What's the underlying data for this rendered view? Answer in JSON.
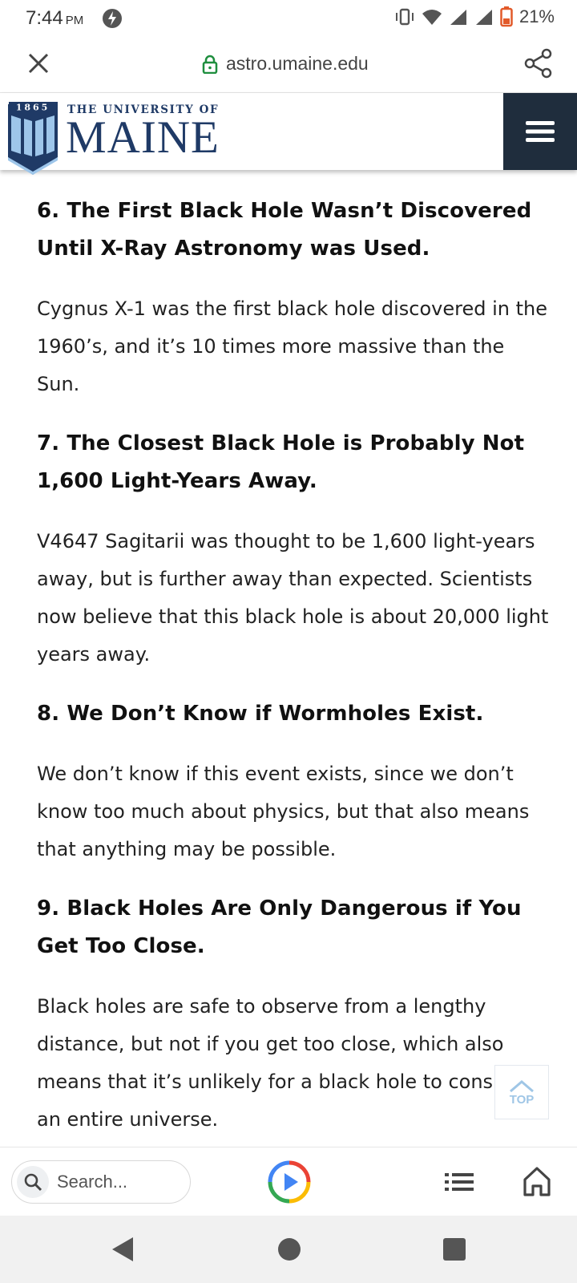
{
  "status_bar": {
    "time": "7:44",
    "ampm": "PM",
    "battery": "21%"
  },
  "browser": {
    "url": "astro.umaine.edu"
  },
  "site": {
    "logo_year": "1865",
    "logo_line1": "THE UNIVERSITY OF",
    "logo_line2": "MAINE",
    "brand_color": "#1f2d3d"
  },
  "article": {
    "sections": [
      {
        "title": "6. The First Black Hole Wasn’t Discovered Until X-Ray Astronomy was Used.",
        "body": "Cygnus X-1 was the first black hole discovered in the 1960’s, and it’s 10 times more massive than the Sun."
      },
      {
        "title": "7. The Closest Black Hole is Probably Not 1,600 Light-Years Away.",
        "body": "V4647 Sagitarii was thought to be 1,600 light-years away, but is further away than expected. Scientists now believe that this black hole is about 20,000 light years away."
      },
      {
        "title": "8. We Don’t Know if Wormholes Exist.",
        "body": "We don’t know if this event exists, since we don’t know too much about physics, but that also means that anything may be possible."
      },
      {
        "title": "9. Black Holes Are Only Dangerous if You Get Too Close.",
        "body": "Black holes are safe to observe from a lengthy distance, but not if you get too close, which also means that it’s unlikely for a black hole to consume an entire universe."
      }
    ]
  },
  "top_button": {
    "label": "TOP"
  },
  "bottom_bar": {
    "search_placeholder": "Search..."
  }
}
